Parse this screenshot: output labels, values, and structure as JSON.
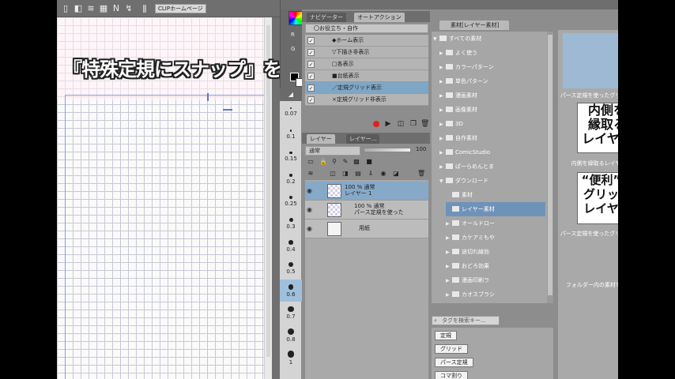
{
  "subtitle": "『特殊定規にスナップ』をONにします。",
  "toolbar": {
    "icons": [
      "panel-icon",
      "layers-icon",
      "grid-icon",
      "ruler-icon",
      "snap-icon",
      "info-icon"
    ],
    "home_label": "CLIPホームページ"
  },
  "color_panel": {
    "r_label": "R",
    "g_label": "G"
  },
  "brush_size": {
    "sizes": [
      "0.07",
      "0.1",
      "0.15",
      "0.2",
      "0.25",
      "0.3",
      "0.4",
      "0.5",
      "0.6",
      "0.7",
      "0.8",
      "1"
    ],
    "selected": "0.6"
  },
  "auto_action": {
    "tabs": [
      "ナビゲーター",
      "オートアクション"
    ],
    "set_name": "〇お役立ち・自作",
    "items": [
      {
        "label": "◆ホーム表示",
        "checked": "✓"
      },
      {
        "label": "▽下描き非表示",
        "checked": "✓"
      },
      {
        "label": "□各表示",
        "checked": "✓"
      },
      {
        "label": "■台紙表示",
        "checked": "✓"
      },
      {
        "label": "／定規グリッド表示",
        "checked": "✓"
      },
      {
        "label": "×定規グリッド非表示",
        "checked": "✓"
      }
    ]
  },
  "layer_panel": {
    "tabs": [
      "レイヤー",
      "レイヤー..."
    ],
    "blend_mode": "通常",
    "opacity": "100",
    "layers": [
      {
        "line1": "100 % 通常",
        "line2": "レイヤー 1"
      },
      {
        "line1": "100 % 通常",
        "line2": "パース定規を使った"
      },
      {
        "line1": "",
        "line2": "用紙"
      }
    ]
  },
  "material": {
    "tab_label": "素材[レイヤー素材]",
    "tree": [
      {
        "label": "すべての素材",
        "level": 0,
        "arrow": "▼"
      },
      {
        "label": "よく使う",
        "level": 1,
        "arrow": "▶"
      },
      {
        "label": "カラーパターン",
        "level": 1,
        "arrow": "▶"
      },
      {
        "label": "単色パターン",
        "level": 1,
        "arrow": "▶"
      },
      {
        "label": "漫画素材",
        "level": 1,
        "arrow": "▶"
      },
      {
        "label": "画像素材",
        "level": 1,
        "arrow": "▶"
      },
      {
        "label": "3D",
        "level": 1,
        "arrow": "▶"
      },
      {
        "label": "自作素材",
        "level": 1,
        "arrow": "▶"
      },
      {
        "label": "ComicStudio",
        "level": 1,
        "arrow": "▶"
      },
      {
        "label": "ぱーらめんとま",
        "level": 1,
        "arrow": "▶"
      },
      {
        "label": "ダウンロード",
        "level": 1,
        "arrow": "▼"
      },
      {
        "label": "素材",
        "level": 2,
        "arrow": ""
      },
      {
        "label": "レイヤー素材",
        "level": 2,
        "arrow": "",
        "selected": true
      },
      {
        "label": "オールドロー",
        "level": 2,
        "arrow": "▶"
      },
      {
        "label": "カケアミもや",
        "level": 2,
        "arrow": "▶"
      },
      {
        "label": "途切れ線効",
        "level": 2,
        "arrow": "▶"
      },
      {
        "label": "おどろ効果",
        "level": 2,
        "arrow": "▶"
      },
      {
        "label": "漫画印刷ラ",
        "level": 2,
        "arrow": "▶"
      },
      {
        "label": "カオスブラシ",
        "level": 2,
        "arrow": "▶"
      }
    ],
    "search_placeholder": "タグを検索キー...",
    "tags": [
      "定規",
      "グリッド",
      "パース定規",
      "コマ割り"
    ],
    "items": [
      {
        "caption": "パース定規を使ったグリッドレイヤー"
      },
      {
        "sign_lines": [
          "内側を",
          "縁取る",
          "レイヤー"
        ],
        "caption": "内側を縁取るレイヤーセット"
      },
      {
        "sign_lines": [
          "“便利”な",
          "グリッド",
          "レイヤー"
        ],
        "caption": "パース定規を使ったグリッドレイヤー"
      }
    ],
    "show_all_label": "フォルダー内の素材をすべて表示"
  },
  "right_strip": {
    "icons": [
      "folder-icon",
      "wand-icon",
      "star-icon",
      "curve-icon",
      "arc-icon",
      "circle-icon",
      "cube-icon",
      "tone-icon",
      "grid-icon",
      "mesh-icon",
      "wave-icon",
      "folder-open-icon"
    ]
  }
}
